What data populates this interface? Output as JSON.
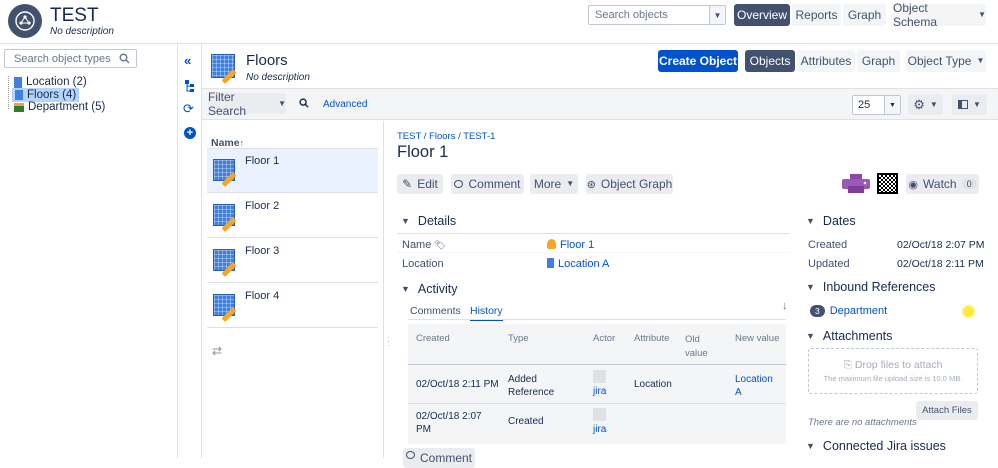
{
  "app": {
    "title": "TEST",
    "description": "No description"
  },
  "top_nav": {
    "search_placeholder": "Search objects",
    "tabs": [
      "Overview",
      "Reports",
      "Graph"
    ],
    "schema_label": "Object Schema"
  },
  "sidebar": {
    "search_placeholder": "Search object types",
    "items": [
      {
        "label": "Location (2)"
      },
      {
        "label": "Floors (4)"
      },
      {
        "label": "Department (5)"
      }
    ]
  },
  "object_type": {
    "name": "Floors",
    "description": "No description",
    "create_label": "Create Object",
    "tabs": [
      "Objects",
      "Attributes",
      "Graph"
    ],
    "type_label": "Object Type"
  },
  "filter": {
    "label": "Filter Search",
    "advanced": "Advanced",
    "page_size": "25"
  },
  "list": {
    "header": "Name",
    "items": [
      "Floor 1",
      "Floor 2",
      "Floor 3",
      "Floor 4"
    ]
  },
  "detail": {
    "breadcrumb": [
      "TEST",
      "Floors",
      "TEST-1"
    ],
    "title": "Floor 1",
    "actions": {
      "edit": "Edit",
      "comment": "Comment",
      "more": "More",
      "graph": "Object Graph"
    },
    "watch_label": "Watch",
    "watch_count": "0",
    "details": {
      "heading": "Details",
      "rows": [
        {
          "label": "Name",
          "value": "Floor 1"
        },
        {
          "label": "Location",
          "value": "Location A"
        }
      ]
    },
    "activity": {
      "heading": "Activity",
      "tabs": [
        "Comments",
        "History"
      ],
      "columns": [
        "Created",
        "Type",
        "Actor",
        "Attribute",
        "Old value",
        "New value"
      ],
      "rows": [
        {
          "created": "02/Oct/18 2:11 PM",
          "type": "Added Reference",
          "actor": "jira",
          "attribute": "Location",
          "old": "",
          "new": "Location A"
        },
        {
          "created": "02/Oct/18 2:07 PM",
          "type": "Created",
          "actor": "jira",
          "attribute": "",
          "old": "",
          "new": ""
        }
      ],
      "comment_button": "Comment"
    },
    "dates": {
      "heading": "Dates",
      "rows": [
        {
          "label": "Created",
          "value": "02/Oct/18 2:07 PM"
        },
        {
          "label": "Updated",
          "value": "02/Oct/18 2:11 PM"
        }
      ]
    },
    "inbound": {
      "heading": "Inbound References",
      "count": "3",
      "label": "Department"
    },
    "attachments": {
      "heading": "Attachments",
      "drop_text": "Drop files to attach",
      "max_text": "The maximum file upload size is 10.0 MB.",
      "empty_text": "There are no attachments",
      "attach_label": "Attach Files"
    },
    "jira": {
      "heading": "Connected Jira issues"
    }
  },
  "colors": {
    "accent": "#0052cc",
    "nav_dark": "#42526e",
    "highlight": "#ffeb3b"
  }
}
